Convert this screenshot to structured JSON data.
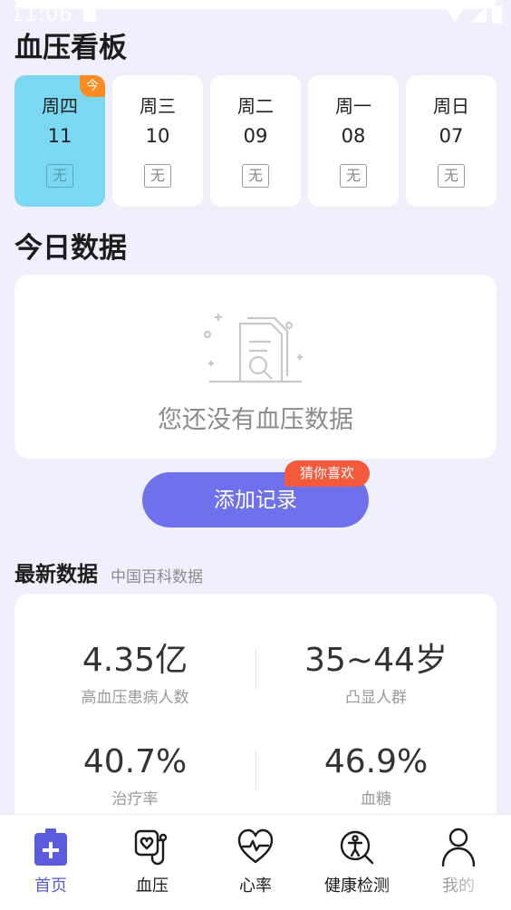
{
  "status_bar": {
    "time": "11:06",
    "colors": {
      "icon": "#ffffff"
    }
  },
  "dashboard": {
    "title": "血压看板"
  },
  "days": [
    {
      "name": "周四",
      "date": "11",
      "status": "无",
      "badge": "今",
      "active": true
    },
    {
      "name": "周三",
      "date": "10",
      "status": "无",
      "active": false
    },
    {
      "name": "周二",
      "date": "09",
      "status": "无",
      "active": false
    },
    {
      "name": "周一",
      "date": "08",
      "status": "无",
      "active": false
    },
    {
      "name": "周日",
      "date": "07",
      "status": "无",
      "active": false
    }
  ],
  "today": {
    "title": "今日数据",
    "empty_text": "您还没有血压数据",
    "empty_icon": "document-search-icon"
  },
  "add_record": {
    "label": "添加记录",
    "badge": "猜你喜欢"
  },
  "latest": {
    "title": "最新数据",
    "source": "中国百科数据",
    "stats": [
      {
        "value": "4.35亿",
        "label": "高血压患病人数"
      },
      {
        "value": "35~44岁",
        "label": "凸显人群"
      },
      {
        "value": "40.7%",
        "label": "治疗率"
      },
      {
        "value": "46.9%",
        "label": "血糖"
      }
    ]
  },
  "nav": [
    {
      "label": "首页",
      "icon": "medical-kit-icon",
      "active": true
    },
    {
      "label": "血压",
      "icon": "blood-pressure-icon",
      "active": false
    },
    {
      "label": "心率",
      "icon": "heart-rate-icon",
      "active": false
    },
    {
      "label": "健康检测",
      "icon": "health-check-icon",
      "active": false
    },
    {
      "label": "我的",
      "icon": "profile-icon",
      "active": false
    }
  ],
  "colors": {
    "background": "#eff0fb",
    "accent": "#6f70ec",
    "active_day": "#7ad8f3",
    "today_badge": "#ff8a1f",
    "recommend_badge": "#f35a3c",
    "nav_active": "#5b5cdc"
  }
}
